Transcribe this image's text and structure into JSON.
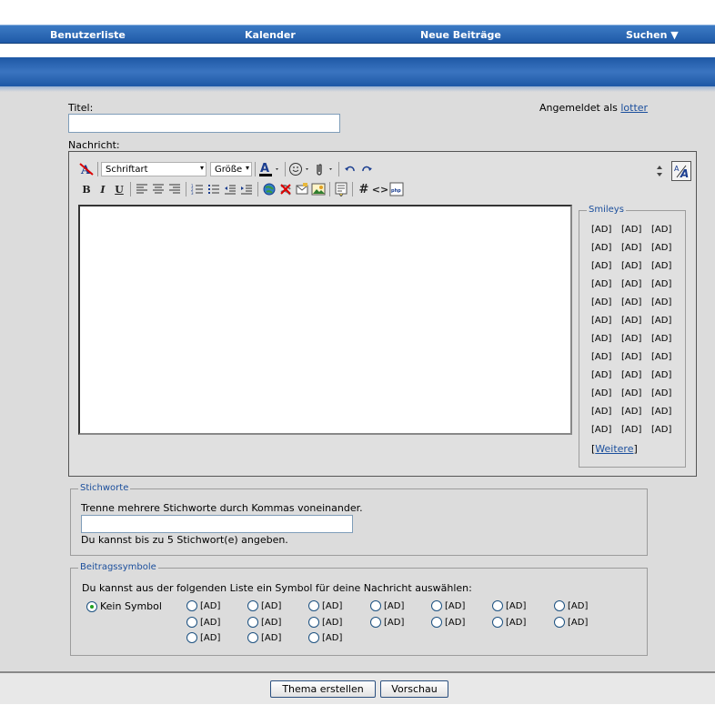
{
  "nav": {
    "items": [
      "Benutzerliste",
      "Kalender",
      "Neue Beiträge",
      "Suchen"
    ],
    "search_arrow": "▼"
  },
  "form": {
    "title_label": "Titel:",
    "logged_in_prefix": "Angemeldet als",
    "username": "lotter",
    "message_label": "Nachricht:"
  },
  "toolbar": {
    "font_label": "Schriftart",
    "size_label": "Größe"
  },
  "smileys": {
    "legend": "Smileys",
    "placeholder": "[AD]",
    "rows": 12,
    "cols": 3,
    "more_open": "[",
    "more_label": "Weitere",
    "more_close": "]"
  },
  "tags": {
    "legend": "Stichworte",
    "hint": "Trenne mehrere Stichworte durch Kommas voneinander.",
    "limit": "Du kannst bis zu 5 Stichwort(e) angeben."
  },
  "icons_section": {
    "legend": "Beitragssymbole",
    "hint": "Du kannst aus der folgenden Liste ein Symbol für deine Nachricht auswählen:",
    "none_label": "Kein Symbol",
    "placeholder": "[AD]",
    "count": 17
  },
  "buttons": {
    "submit": "Thema erstellen",
    "preview": "Vorschau"
  },
  "colors": {
    "nav": "#2a67b4",
    "link": "#1a4e9c",
    "background": "#dcdcdc"
  }
}
